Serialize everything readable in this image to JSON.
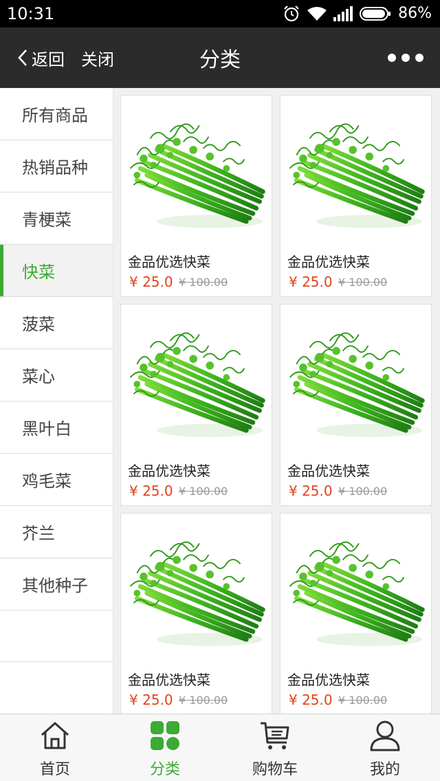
{
  "status_bar": {
    "time": "10:31",
    "battery": "86%",
    "icons": [
      "alarm-icon",
      "wifi-icon",
      "signal-icon",
      "battery-icon"
    ]
  },
  "nav": {
    "back_label": "返回",
    "close_label": "关闭",
    "title": "分类",
    "more_icon": "more-dots-icon"
  },
  "sidebar": {
    "items": [
      {
        "label": "所有商品"
      },
      {
        "label": "热销品种"
      },
      {
        "label": "青梗菜"
      },
      {
        "label": "快菜"
      },
      {
        "label": "菠菜"
      },
      {
        "label": "菜心"
      },
      {
        "label": "黑叶白"
      },
      {
        "label": "鸡毛菜"
      },
      {
        "label": "芥兰"
      },
      {
        "label": "其他种子"
      }
    ],
    "active_index": 3
  },
  "products": [
    {
      "name": "金品优选快菜",
      "price": "¥ 25.0",
      "old_price": "¥ 100.00"
    },
    {
      "name": "金品优选快菜",
      "price": "¥ 25.0",
      "old_price": "¥ 100.00"
    },
    {
      "name": "金品优选快菜",
      "price": "¥ 25.0",
      "old_price": "¥ 100.00"
    },
    {
      "name": "金品优选快菜",
      "price": "¥ 25.0",
      "old_price": "¥ 100.00"
    },
    {
      "name": "金品优选快菜",
      "price": "¥ 25.0",
      "old_price": "¥ 100.00"
    },
    {
      "name": "金品优选快菜",
      "price": "¥ 25.0",
      "old_price": "¥ 100.00"
    }
  ],
  "tabbar": {
    "items": [
      {
        "label": "首页",
        "icon": "home-icon"
      },
      {
        "label": "分类",
        "icon": "category-icon"
      },
      {
        "label": "购物车",
        "icon": "cart-icon"
      },
      {
        "label": "我的",
        "icon": "user-icon"
      }
    ],
    "active_index": 1
  },
  "colors": {
    "accent": "#3daa34",
    "price": "#e2431c",
    "nav_bg": "#2b2b2b"
  }
}
